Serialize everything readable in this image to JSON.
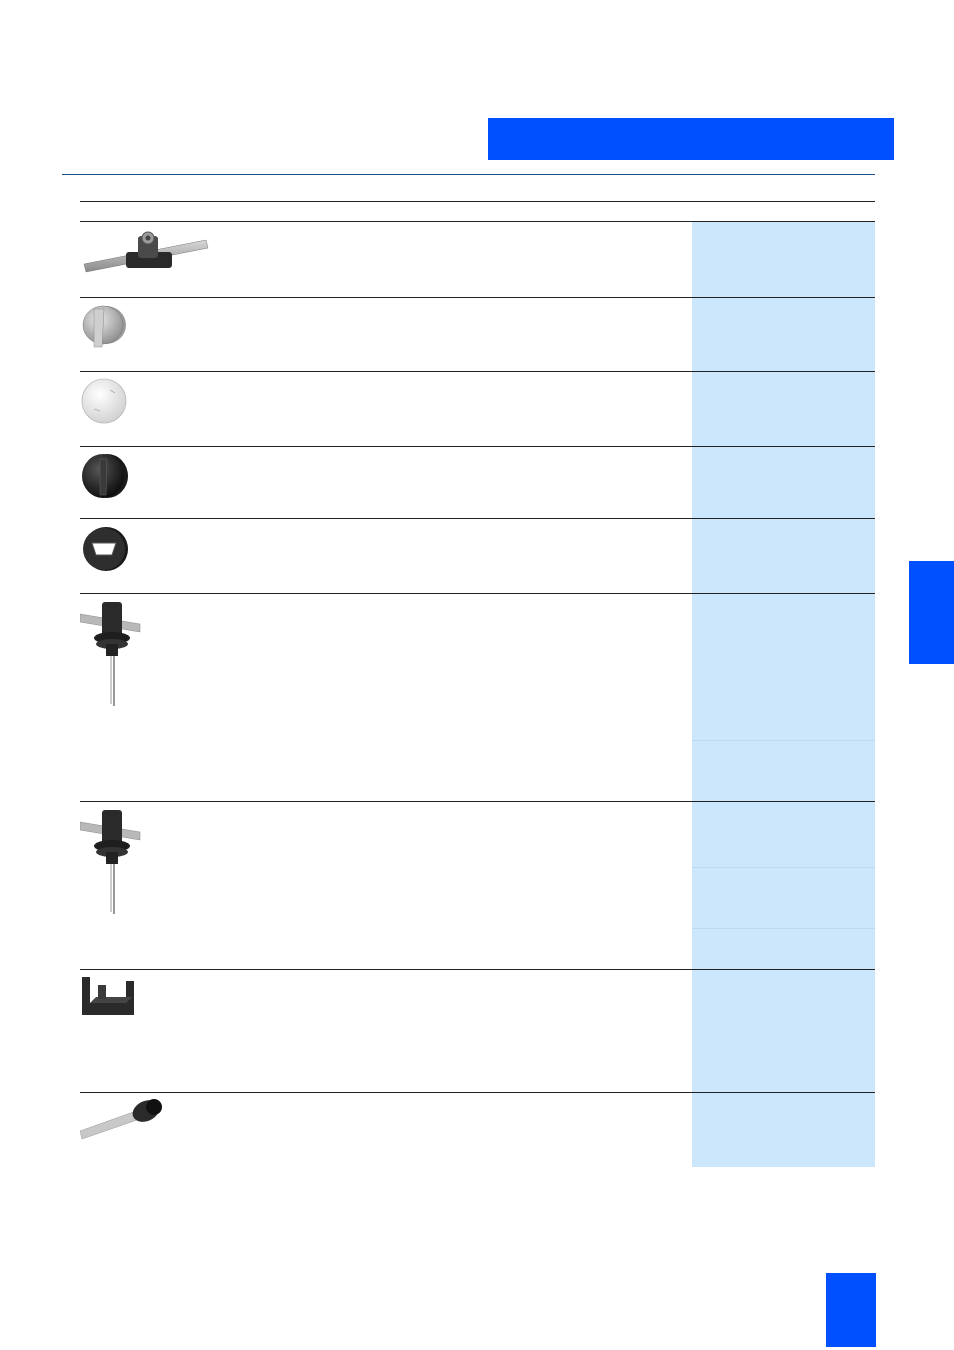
{
  "colors": {
    "accent_blue": "#0050ff",
    "column_fill": "#cce6fc",
    "rule_dark": "#1b4f8a"
  },
  "header": {
    "title": ""
  },
  "side_tab": {
    "label": ""
  },
  "page_number": "",
  "table": {
    "rows": [
      {
        "photo": "connector-clamp-on-cable-photo"
      },
      {
        "photo": "grey-knob-photo"
      },
      {
        "photo": "white-cap-photo"
      },
      {
        "photo": "black-knob-photo"
      },
      {
        "photo": "black-ring-photo"
      },
      {
        "photo": "clamp-with-cable-photo"
      },
      {
        "photo": "clamp-with-cable-photo"
      },
      {
        "photo": "bracket-clip-photo"
      },
      {
        "photo": "cable-end-plug-photo"
      }
    ]
  }
}
